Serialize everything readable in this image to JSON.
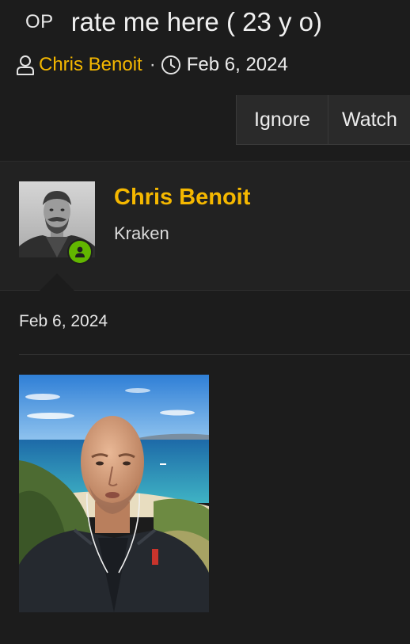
{
  "thread": {
    "op_badge": "OP",
    "title": "rate me here ( 23 y o)",
    "author": "Chris Benoit",
    "separator": "·",
    "date": "Feb 6, 2024"
  },
  "actions": {
    "ignore_label": "Ignore",
    "watch_label": "Watch"
  },
  "post": {
    "username": "Chris Benoit",
    "user_title": "Kraken",
    "date": "Feb 6, 2024",
    "online": true
  },
  "colors": {
    "background": "#1c1c1c",
    "accent_username": "#f5b800",
    "online_status": "#62b600",
    "button_bg": "#2a2a2a"
  },
  "icons": {
    "author": "user-icon",
    "date": "clock-icon",
    "online": "online-user-icon"
  }
}
